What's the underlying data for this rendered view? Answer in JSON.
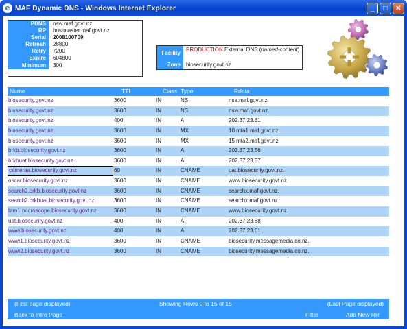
{
  "window": {
    "title": "MAF Dynamic DNS - Windows Internet Explorer",
    "app_icon": "ie-icon",
    "buttons": [
      "minimize",
      "maximize",
      "close"
    ]
  },
  "soa": [
    {
      "key": "PDNS",
      "value": "nsw.maf.govt.nz"
    },
    {
      "key": "RP",
      "value": "hostmaster.maf.govt.nz"
    },
    {
      "key": "Serial",
      "value": "2008100709"
    },
    {
      "key": "Refresh",
      "value": "28800"
    },
    {
      "key": "Retry",
      "value": "7200"
    },
    {
      "key": "Expire",
      "value": "604800"
    },
    {
      "key": "Minimum",
      "value": "300"
    }
  ],
  "facility": {
    "facility_label": "Facility",
    "production": "PRODUCTION",
    "external": " External DNS (",
    "named": "named-content",
    "close_paren": ")",
    "zone_label": "Zone",
    "zone_value": "biosecurity.govt.nz"
  },
  "table": {
    "headers": {
      "name": "Name",
      "ttl": "TTL",
      "class": "Class",
      "type": "Type",
      "rdata": "Rdata"
    },
    "rows": [
      {
        "name": "biosecurity.govt.nz",
        "ttl": "3600",
        "class": "IN",
        "type": "NS",
        "rdata": "nsa.maf.govt.nz."
      },
      {
        "name": "biosecurity.govt.nz",
        "ttl": "3600",
        "class": "IN",
        "type": "NS",
        "rdata": "nsw.maf.govt.nz."
      },
      {
        "name": "biosecurity.govt.nz",
        "ttl": "400",
        "class": "IN",
        "type": "A",
        "rdata": "202.37.23.61"
      },
      {
        "name": "biosecurity.govt.nz",
        "ttl": "3600",
        "class": "IN",
        "type": "MX",
        "rdata": "10 mta1.maf.govt.nz."
      },
      {
        "name": "biosecurity.govt.nz",
        "ttl": "3600",
        "class": "IN",
        "type": "MX",
        "rdata": "15 mta2.maf.govt.nz."
      },
      {
        "name": "brkb.biosecurity.govt.nz",
        "ttl": "3600",
        "class": "IN",
        "type": "A",
        "rdata": "202.37.23.56"
      },
      {
        "name": "brkbuat.biosecurity.govt.nz",
        "ttl": "3600",
        "class": "IN",
        "type": "A",
        "rdata": "202.37.23.57"
      },
      {
        "name": "cameraa.biosecurity.govt.nz",
        "ttl": "60",
        "class": "IN",
        "type": "CNAME",
        "rdata": "uat.biosecurity.govt.nz."
      },
      {
        "name": "oscar.biosecurity.govt.nz",
        "ttl": "3600",
        "class": "IN",
        "type": "CNAME",
        "rdata": "www.biosecurity.govt.nz."
      },
      {
        "name": "search2.brkb.biosecurity.govt.nz",
        "ttl": "3600",
        "class": "IN",
        "type": "CNAME",
        "rdata": "searchx.maf.govt.nz."
      },
      {
        "name": "search2.brkbuat.biosecurity.govt.nz",
        "ttl": "3600",
        "class": "IN",
        "type": "CNAME",
        "rdata": "searchx.maf.govt.nz."
      },
      {
        "name": "tam1.microscope.biosecurity.govt.nz",
        "ttl": "3600",
        "class": "IN",
        "type": "CNAME",
        "rdata": "www.biosecurity.govt.nz."
      },
      {
        "name": "uat.biosecurity.govt.nz",
        "ttl": "400",
        "class": "IN",
        "type": "A",
        "rdata": "202.37.23.68"
      },
      {
        "name": "www.biosecurity.govt.nz",
        "ttl": "400",
        "class": "IN",
        "type": "A",
        "rdata": "202.37.23.61"
      },
      {
        "name": "www1.biosecurity.govt.nz",
        "ttl": "3600",
        "class": "IN",
        "type": "CNAME",
        "rdata": "biosecurity.messagemedia.co.nz."
      },
      {
        "name": "www2.biosecurity.govt.nz",
        "ttl": "3600",
        "class": "IN",
        "type": "CNAME",
        "rdata": "biosecurity.messagemedia.co.nz."
      }
    ]
  },
  "footer": {
    "first_page": "(First page displayed)",
    "showing": "Showing Rows 0 to 15 of 15",
    "last_page": "(Last Page displayed)",
    "back": "Back to Intro Page",
    "filter": "Filter",
    "add_new": "Add New RR"
  },
  "colors": {
    "accent": "#3399ff",
    "row_shade": "#aed4f7",
    "link": "#5b2a86",
    "production": "#cc0000",
    "titlebar": "#0a49d6"
  }
}
